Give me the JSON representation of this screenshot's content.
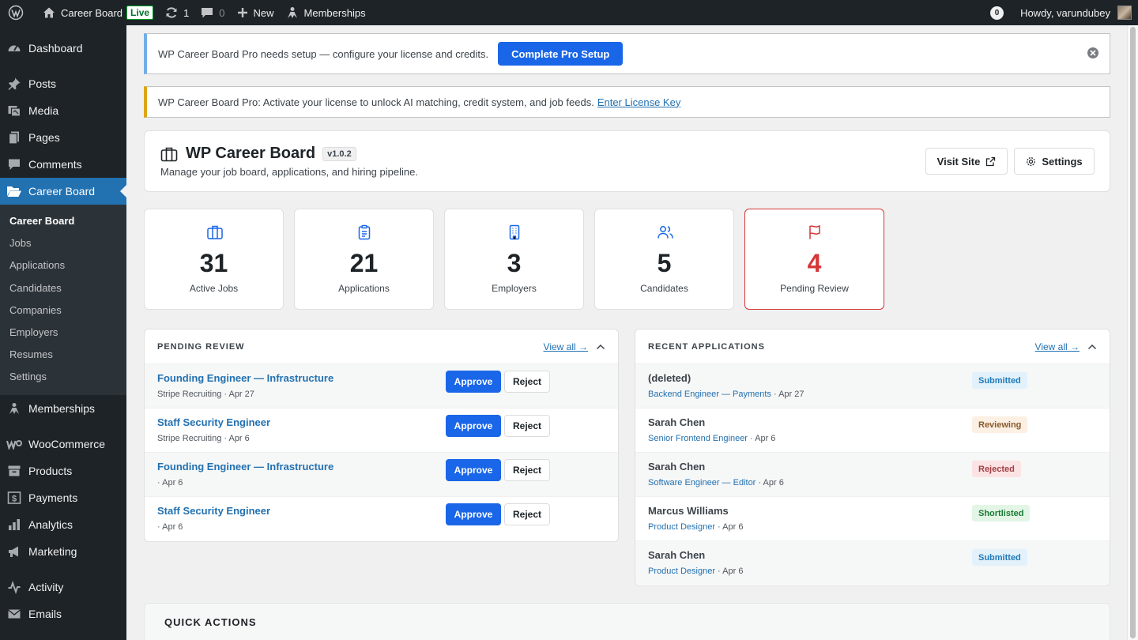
{
  "admin_bar": {
    "site_name": "Career Board",
    "live_badge": "Live",
    "updates_count": "1",
    "comments_count": "0",
    "new_label": "New",
    "memberships_label": "Memberships",
    "notifications_count": "0",
    "howdy": "Howdy, varundubey"
  },
  "sidebar": {
    "dashboard": "Dashboard",
    "posts": "Posts",
    "media": "Media",
    "pages": "Pages",
    "comments": "Comments",
    "career_board": "Career Board",
    "submenu": [
      "Career Board",
      "Jobs",
      "Applications",
      "Candidates",
      "Companies",
      "Employers",
      "Resumes",
      "Settings"
    ],
    "memberships": "Memberships",
    "woocommerce": "WooCommerce",
    "products": "Products",
    "payments": "Payments",
    "analytics": "Analytics",
    "marketing": "Marketing",
    "activity": "Activity",
    "emails": "Emails"
  },
  "notices": {
    "setup_text": "WP Career Board Pro needs setup — configure your license and credits.",
    "setup_button": "Complete Pro Setup",
    "license_text": "WP Career Board Pro: Activate your license to unlock AI matching, credit system, and job feeds.",
    "license_link": "Enter License Key"
  },
  "header": {
    "title": "WP Career Board",
    "version": "v1.0.2",
    "subtitle": "Manage your job board, applications, and hiring pipeline.",
    "visit_site": "Visit Site",
    "settings": "Settings"
  },
  "stats": [
    {
      "value": "31",
      "label": "Active Jobs"
    },
    {
      "value": "21",
      "label": "Applications"
    },
    {
      "value": "3",
      "label": "Employers"
    },
    {
      "value": "5",
      "label": "Candidates"
    },
    {
      "value": "4",
      "label": "Pending Review"
    }
  ],
  "pending": {
    "title": "PENDING REVIEW",
    "view_all": "View all →",
    "approve": "Approve",
    "reject": "Reject",
    "rows": [
      {
        "title": "Founding Engineer — Infrastructure",
        "meta": "Stripe Recruiting · Apr 27"
      },
      {
        "title": "Staff Security Engineer",
        "meta": "Stripe Recruiting · Apr 6"
      },
      {
        "title": "Founding Engineer — Infrastructure",
        "meta": "· Apr 6"
      },
      {
        "title": "Staff Security Engineer",
        "meta": "· Apr 6"
      }
    ]
  },
  "recent": {
    "title": "RECENT APPLICATIONS",
    "view_all": "View all →",
    "rows": [
      {
        "name": "(deleted)",
        "job": "Backend Engineer — Payments",
        "date": " · Apr 27",
        "status": "Submitted"
      },
      {
        "name": "Sarah Chen",
        "job": "Senior Frontend Engineer",
        "date": " · Apr 6",
        "status": "Reviewing"
      },
      {
        "name": "Sarah Chen",
        "job": "Software Engineer — Editor",
        "date": " · Apr 6",
        "status": "Rejected"
      },
      {
        "name": "Marcus Williams",
        "job": "Product Designer",
        "date": " · Apr 6",
        "status": "Shortlisted"
      },
      {
        "name": "Sarah Chen",
        "job": "Product Designer",
        "date": " · Apr 6",
        "status": "Submitted"
      }
    ]
  },
  "quick_actions": {
    "title": "QUICK ACTIONS"
  }
}
